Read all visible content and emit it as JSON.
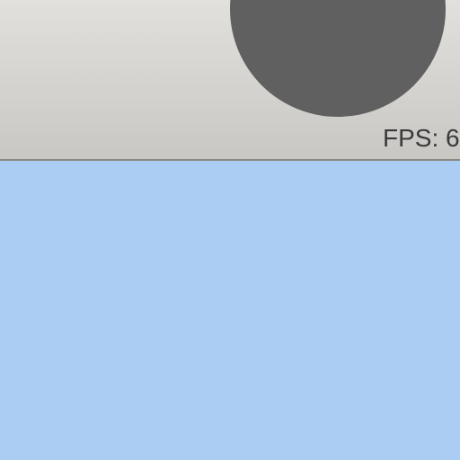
{
  "toolbar": {
    "collapse_icon": "chevron-down-icon",
    "fps_text": "FPS: 6"
  },
  "colors": {
    "toolbar_background": "#d6d4d0",
    "button_background": "#606060",
    "icon_color": "#ffffff",
    "fps_text_color": "#3a3a3a",
    "canvas_background": "#abcdf3"
  }
}
